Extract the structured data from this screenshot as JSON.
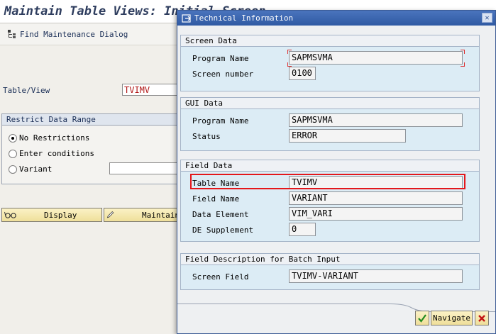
{
  "background": {
    "title": "Maintain Table Views: Initial Screen",
    "toolbar": {
      "find_label": "Find Maintenance Dialog"
    },
    "table_view": {
      "label": "Table/View",
      "value": "TVIMV"
    },
    "restrict": {
      "heading": "Restrict Data Range",
      "options": [
        {
          "label": "No Restrictions",
          "selected": true
        },
        {
          "label": "Enter conditions",
          "selected": false
        },
        {
          "label": "Variant",
          "selected": false
        }
      ],
      "variant_value": ""
    },
    "buttons": {
      "display": "Display",
      "maintain": "Maintain"
    }
  },
  "dialog": {
    "title": "Technical Information",
    "groups": {
      "screen_data": {
        "heading": "Screen Data",
        "program_name": {
          "label": "Program Name",
          "value": "SAPMSVMA"
        },
        "screen_number": {
          "label": "Screen number",
          "value": "0100"
        }
      },
      "gui_data": {
        "heading": "GUI Data",
        "program_name": {
          "label": "Program Name",
          "value": "SAPMSVMA"
        },
        "status": {
          "label": "Status",
          "value": "ERROR"
        }
      },
      "field_data": {
        "heading": "Field Data",
        "table_name": {
          "label": "Table Name",
          "value": "TVIMV"
        },
        "field_name": {
          "label": "Field Name",
          "value": "VARIANT"
        },
        "data_element": {
          "label": "Data Element",
          "value": "VIM_VARI"
        },
        "de_supplement": {
          "label": "DE Supplement",
          "value": "0"
        }
      },
      "batch_input": {
        "heading": "Field Description for Batch Input",
        "screen_field": {
          "label": "Screen Field",
          "value": "TVIMV-VARIANT"
        }
      }
    },
    "footer": {
      "navigate_label": "Navigate"
    }
  },
  "colors": {
    "highlight": "#e4171b",
    "title_bar": "#2f5aa3",
    "group_bg": "#dcecf5"
  }
}
